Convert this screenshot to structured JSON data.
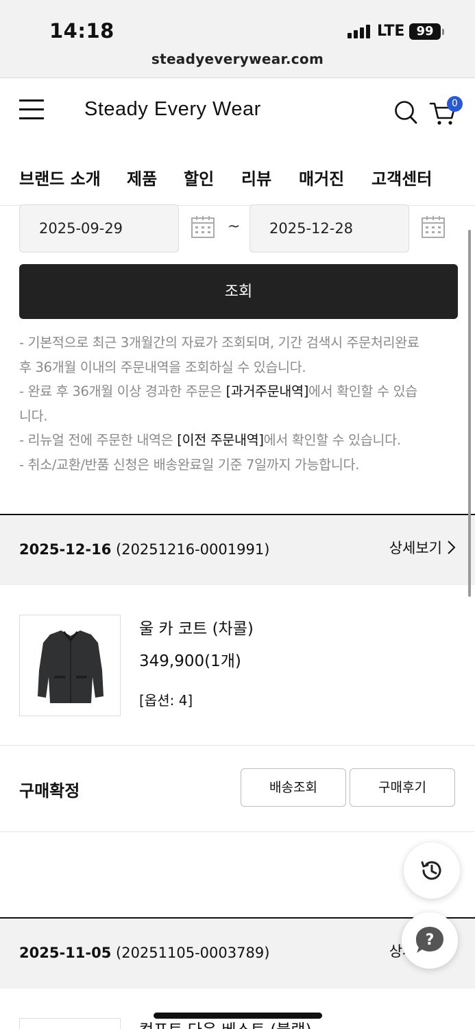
{
  "status_bar": {
    "time": "14:18",
    "network": "LTE",
    "battery": "99",
    "url": "steadyeverywear.com"
  },
  "header": {
    "logo": "Steady Every Wear",
    "cart_count": "0",
    "nav": [
      "브랜드 소개",
      "제품",
      "할인",
      "리뷰",
      "매거진",
      "고객센터"
    ]
  },
  "filter": {
    "start_date": "2025-09-29",
    "separator": "~",
    "end_date": "2025-12-28",
    "search_label": "조회"
  },
  "notes": {
    "line1": "- 기본적으로 최근 3개월간의 자료가 조회되며, 기간 검색시 주문처리완료",
    "line2": "후 36개월 이내의 주문내역을 조회하실 수 있습니다.",
    "line3_pre": "- 완료 후 36개월 이상 경과한 주문은 ",
    "line3_link": "[과거주문내역]",
    "line3_post": "에서 확인할 수 있습",
    "line4": "니다.",
    "line5_pre": "- 리뉴얼 전에 주문한 내역은 ",
    "line5_link": "[이전 주문내역]",
    "line5_post": "에서 확인할 수 있습니다.",
    "line6": "- 취소/교환/반품 신청은 배송완료일 기준 7일까지 가능합니다."
  },
  "orders": [
    {
      "date": "2025-12-16",
      "number": "(20251216-0001991)",
      "detail_label": "상세보기",
      "product_name": "울 카 코트 (차콜)",
      "price": "349,900(1개)",
      "option": "[옵션: 4]",
      "status": "구매확정",
      "buttons": [
        "배송조회",
        "구매후기"
      ]
    },
    {
      "date": "2025-11-05",
      "number": "(20251105-0003789)",
      "detail_label": "상세보기",
      "product_name": "컴포트 다운 베스트 (블랙)"
    }
  ],
  "colors": {
    "cart_badge": "#2a59d6",
    "primary_button": "#222222",
    "note_text": "#8a8a8a"
  },
  "icons": [
    "menu-icon",
    "search-icon",
    "cart-icon",
    "calendar-icon",
    "chevron-right-icon",
    "history-icon",
    "help-icon"
  ]
}
